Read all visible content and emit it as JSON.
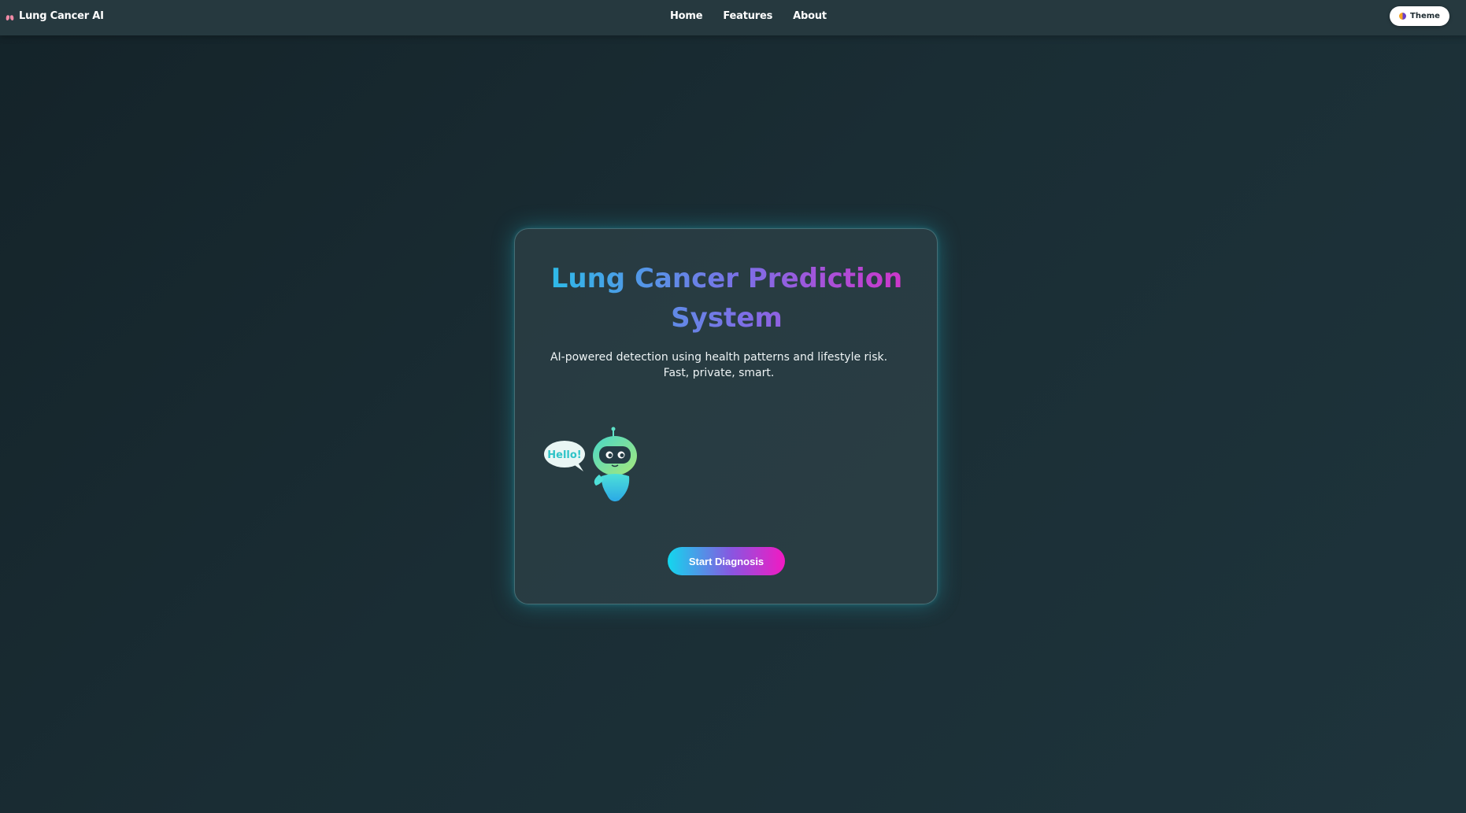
{
  "nav": {
    "brand": "Lung Cancer AI",
    "brand_icon": "lungs-icon",
    "links": [
      "Home",
      "Features",
      "About"
    ],
    "theme_label": "Theme",
    "theme_icon": "half-circle-theme-icon"
  },
  "hero": {
    "title": "Lung Cancer Prediction System",
    "subtitle": "AI-powered detection using health patterns and lifestyle risk. Fast, private, smart.",
    "bubble_text": "Hello!",
    "cta_label": "Start Diagnosis"
  },
  "colors": {
    "background": "#1a2d34",
    "navbar": "#26393f",
    "accent_cyan": "#13d7ee",
    "accent_purple": "#8a55e0",
    "accent_magenta": "#f21ac2"
  }
}
